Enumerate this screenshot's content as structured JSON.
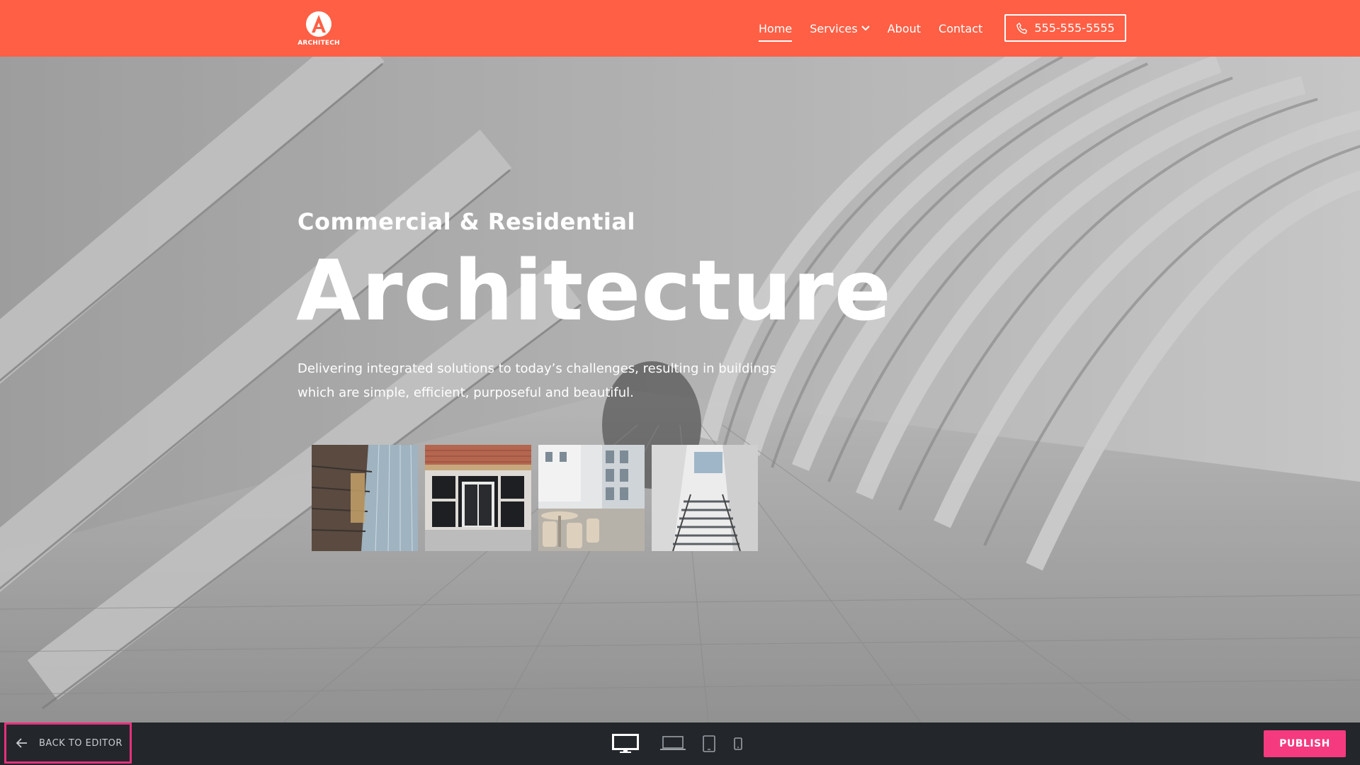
{
  "header": {
    "logo_text": "ARCHITECH",
    "nav": [
      {
        "label": "Home",
        "active": true
      },
      {
        "label": "Services",
        "has_dropdown": true
      },
      {
        "label": "About"
      },
      {
        "label": "Contact"
      }
    ],
    "phone": "555-555-5555",
    "background_color": "#ff5f45"
  },
  "hero": {
    "eyebrow": "Commercial & Residential",
    "title": "Architecture",
    "description": "Delivering integrated solutions to today’s challenges, resulting in buildings which are simple, efficient, purposeful and beautiful.",
    "thumbnails": [
      {
        "icon": "glass-tower-photo"
      },
      {
        "icon": "storefront-photo"
      },
      {
        "icon": "courtyard-cafe-photo"
      },
      {
        "icon": "stair-atrium-photo"
      }
    ]
  },
  "editor_bar": {
    "back_label": "BACK TO EDITOR",
    "devices": [
      "desktop-icon",
      "laptop-icon",
      "tablet-icon",
      "mobile-icon"
    ],
    "active_device": "desktop-icon",
    "publish_label": "PUBLISH",
    "accent_color": "#f53a80"
  }
}
